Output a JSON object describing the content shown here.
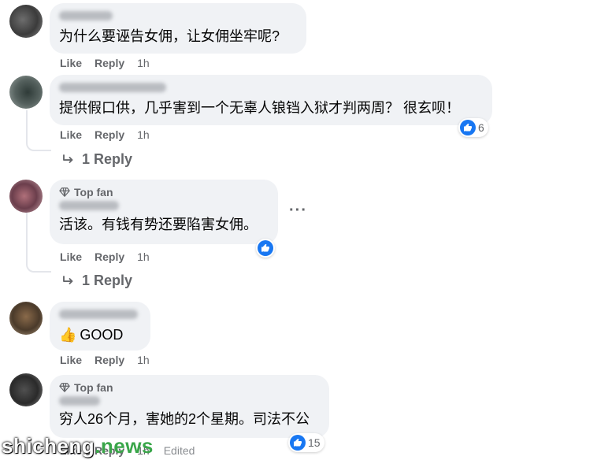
{
  "comments": [
    {
      "text": "为什么要诬告女佣，让女佣坐牢呢?",
      "like": "Like",
      "reply": "Reply",
      "time": "1h"
    },
    {
      "text": "提供假口供，几乎害到一个无辜人锒铛入狱才判两周？ 很玄呗！",
      "like": "Like",
      "reply": "Reply",
      "time": "1h",
      "reactions": "6",
      "replies": "1 Reply"
    },
    {
      "badge": "Top fan",
      "text": "活该。有钱有势还要陷害女佣。",
      "like": "Like",
      "reply": "Reply",
      "time": "1h",
      "replies": "1 Reply",
      "more": "···"
    },
    {
      "emoji": "👍",
      "text": "GOOD",
      "like": "Like",
      "reply": "Reply",
      "time": "1h"
    },
    {
      "badge": "Top fan",
      "text": "穷人26个月，害她的2个星期。司法不公",
      "like": "Like",
      "reply": "Reply",
      "time": "1h",
      "edited": "Edited",
      "reactions": "15"
    }
  ],
  "watermark": {
    "part1": "shicheng",
    "part2": ".news"
  },
  "colors": {
    "bubble": "#f0f2f5",
    "like_blue": "#1877f2",
    "meta_gray": "#65676b",
    "watermark_green": "#3aa64a"
  },
  "icons": {
    "reply_arrow": "reply-arrow-icon",
    "top_fan": "diamond-icon",
    "like_reaction": "thumbs-up-icon",
    "more": "more-options-icon"
  }
}
